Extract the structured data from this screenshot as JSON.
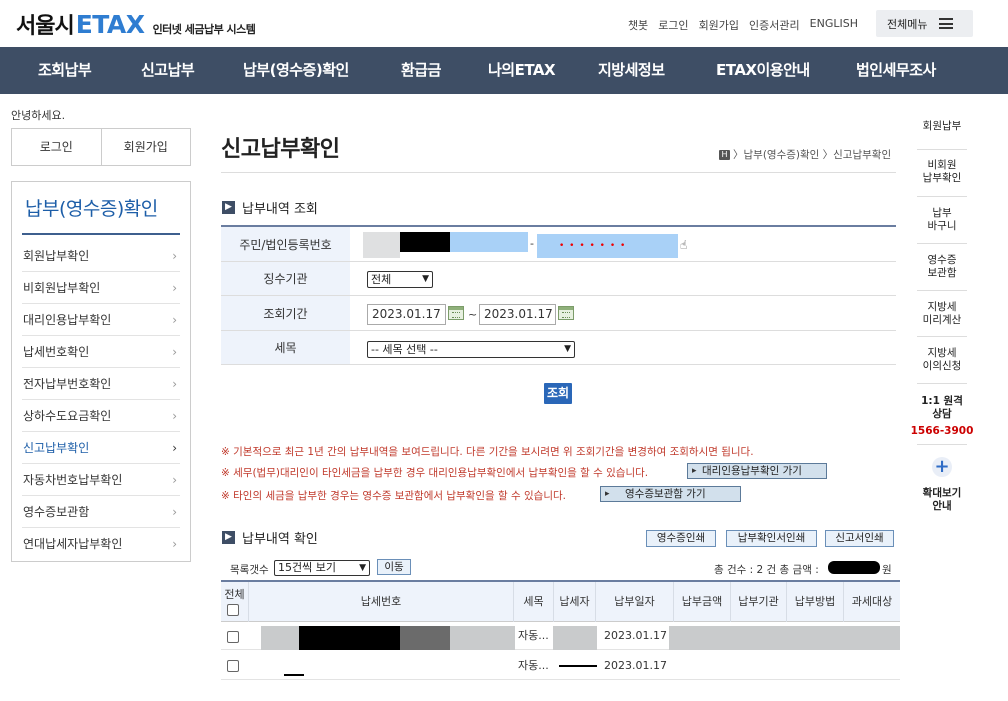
{
  "header": {
    "logo_korean": "서울시",
    "logo_etax": "ETAX",
    "logo_sub": "인터넷 세금납부 시스템",
    "links": [
      "챗봇",
      "로그인",
      "회원가입",
      "인증서관리",
      "ENGLISH"
    ],
    "all_menu": "전체메뉴"
  },
  "gnb": [
    "조회납부",
    "신고납부",
    "납부(영수증)확인",
    "환급금",
    "나의ETAX",
    "지방세정보",
    "ETAX이용안내",
    "법인세무조사"
  ],
  "left": {
    "greeting": "안녕하세요.",
    "login": "로그인",
    "join": "회원가입",
    "menu_title": "납부(영수증)확인",
    "items": [
      "회원납부확인",
      "비회원납부확인",
      "대리인용납부확인",
      "납세번호확인",
      "전자납부번호확인",
      "상하수도요금확인",
      "신고납부확인",
      "자동차번호납부확인",
      "영수증보관함",
      "연대납세자납부확인"
    ],
    "chevron": "›"
  },
  "rail": {
    "items": [
      "회원납부",
      "비회원\n납부확인",
      "납부\n바구니",
      "영수증\n보관함",
      "지방세\n미리계산",
      "지방세\n이의신청",
      "1:1 원격\n상담"
    ],
    "phone": "1566-3900",
    "zoom_icon": "+",
    "zoom_label": "확대보기\n안내"
  },
  "page": {
    "title": "신고납부확인",
    "breadcrumb_icon": "H",
    "breadcrumb": " 〉납부(영수증)확인 〉신고납부확인"
  },
  "query": {
    "section_title": "납부내역 조회",
    "id_label": "주민/법인등록번호",
    "id_dash": "-",
    "id_masked": "• • • • • • •",
    "agency_label": "징수기관",
    "agency_value": "전체",
    "period_label": "조회기간",
    "date_from": "2023.01.17",
    "date_sep": "~",
    "date_to": "2023.01.17",
    "item_label": "세목",
    "item_value": "-- 세목 선택 --",
    "search_button": "조회"
  },
  "notes": {
    "n1": "※ 기본적으로 최근 1년 간의 납부내역을 보여드립니다. 다른 기간을 보시려면 위 조회기간을 변경하여 조회하시면 됩니다.",
    "n2": "※ 세무(법무)대리인이 타인세금을 납부한 경우 대리인용납부확인에서 납부확인을 할 수 있습니다.",
    "n2_button": "대리인용납부확인 가기",
    "n3": "※ 타인의 세금을 납부한 경우는 영수증 보관함에서 납부확인을 할 수 있습니다.",
    "n3_button": "영수증보관함 가기"
  },
  "results": {
    "section_title": "납부내역 확인",
    "buttons": [
      "영수증인쇄",
      "납부확인서인쇄",
      "신고서인쇄"
    ],
    "list_count_label": "목록갯수",
    "list_count_value": "15건씩 보기",
    "move_button": "이동",
    "total_prefix": "총 건수 : 2 건 총 금액 :",
    "total_suffix": "원",
    "columns": [
      "전체",
      "납세번호",
      "세목",
      "납세자",
      "납부일자",
      "납부금액",
      "납부기관",
      "납부방법",
      "과세대상"
    ],
    "rows": [
      {
        "item": "자동...",
        "date": "2023.01.17"
      },
      {
        "item": "자동...",
        "date": "2023.01.17"
      }
    ]
  }
}
